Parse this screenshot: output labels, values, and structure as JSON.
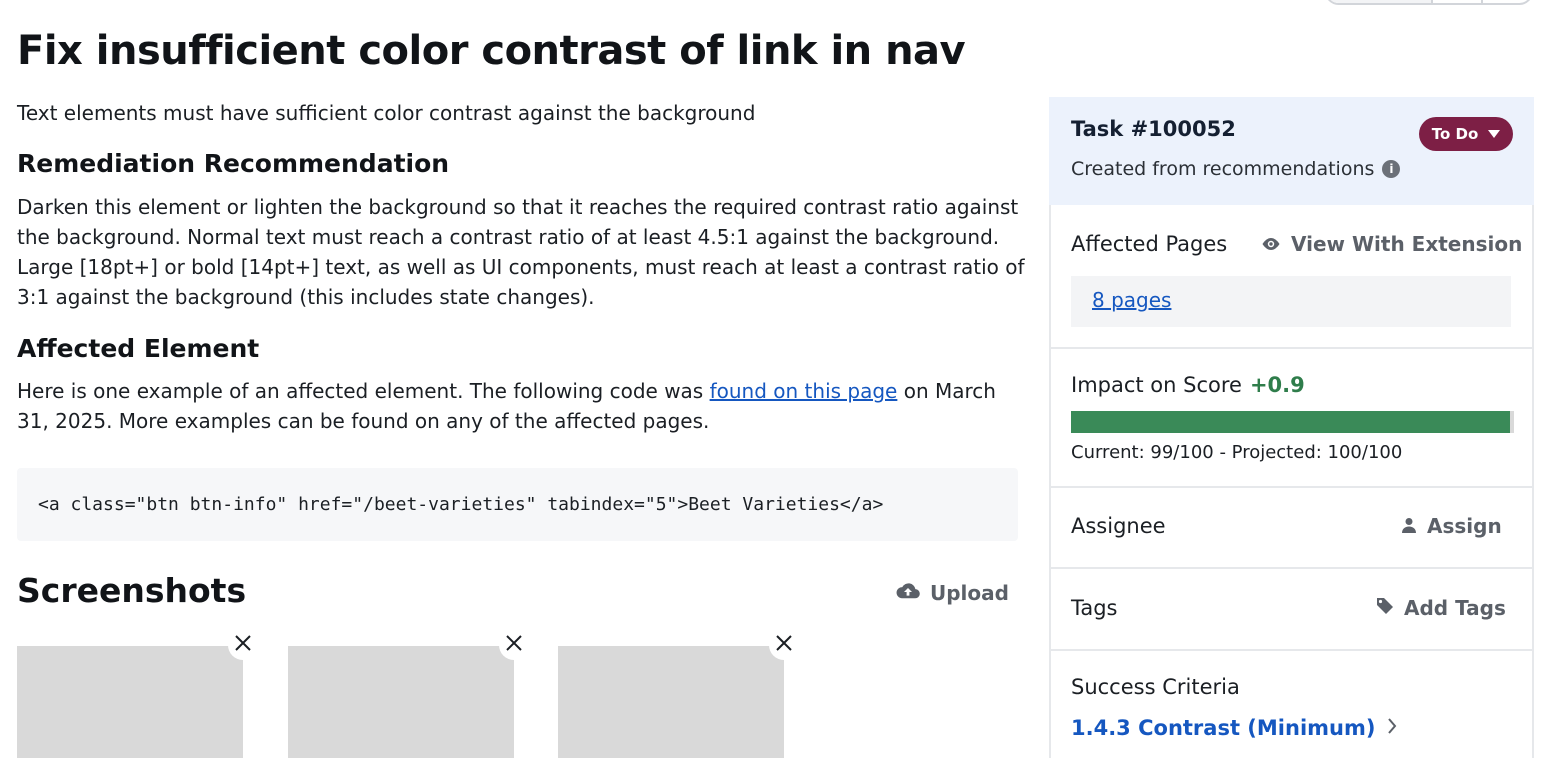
{
  "page": {
    "title": "Fix insufficient color contrast of link in nav",
    "description": "Text elements must have sufficient color contrast against the background"
  },
  "remediation": {
    "heading": "Remediation Recommendation",
    "body": "Darken this element or lighten the background so that it reaches the required contrast ratio against the background. Normal text must reach a contrast ratio of at least 4.5:1 against the background. Large [18pt+] or bold [14pt+] text, as well as UI components, must reach at least a contrast ratio of 3:1 against the background (this includes state changes)."
  },
  "affected_element": {
    "heading": "Affected Element",
    "body_before": "Here is one example of an affected element. The following code was ",
    "link_text": "found on this page",
    "body_after": " on March 31, 2025. More examples can be found on any of the affected pages.",
    "code": "<a class=\"btn btn-info\" href=\"/beet-varieties\" tabindex=\"5\">Beet Varieties</a>"
  },
  "screenshots": {
    "heading": "Screenshots",
    "upload_label": "Upload",
    "count": 3
  },
  "sidebar": {
    "task_number": "Task #100052",
    "created_from": "Created from recommendations",
    "status_label": "To Do",
    "affected_pages": {
      "label": "Affected Pages",
      "action": "View With Extension",
      "pages_link": "8 pages"
    },
    "impact": {
      "label": "Impact on Score",
      "value": "+0.9",
      "progress_fraction": 0.99,
      "progress_text": "Current: 99/100 - Projected: 100/100"
    },
    "assignee": {
      "label": "Assignee",
      "action": "Assign"
    },
    "tags": {
      "label": "Tags",
      "action": "Add Tags"
    },
    "success_criteria": {
      "label": "Success Criteria",
      "link": "1.4.3 Contrast (Minimum)"
    }
  },
  "icons": {
    "upload": "cloud-upload-icon",
    "view": "eye-icon",
    "assign": "user-icon",
    "tags": "tag-icon",
    "info": "info-icon",
    "close": "close-icon",
    "chevron": "chevron-right-icon",
    "caret": "caret-down-icon"
  },
  "colors": {
    "link": "#1557c0",
    "status_badge": "#7d1f45",
    "impact_positive": "#2f7d4b",
    "progress_fill": "#3a8a58",
    "sidebar_header_bg": "#ecf2fc"
  }
}
